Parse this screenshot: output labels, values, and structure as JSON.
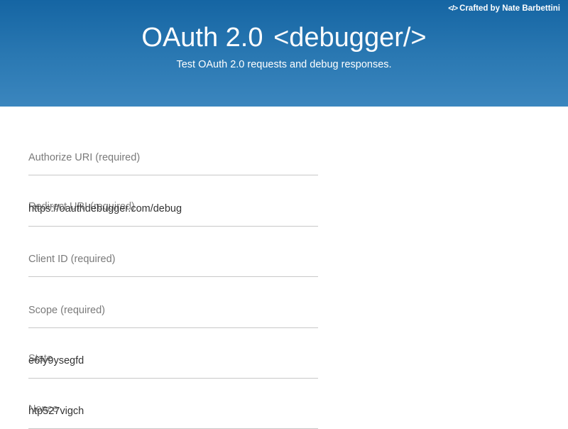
{
  "header": {
    "credit": {
      "icon": "code-icon",
      "icon_glyph": "</>",
      "text": "Crafted by Nate Barbettini"
    },
    "title_main": "OAuth 2.0",
    "title_tag": "<debugger/>",
    "subtitle": "Test OAuth 2.0 requests and debug responses."
  },
  "form": {
    "authorize_uri": {
      "label": "Authorize URI (required)",
      "value": ""
    },
    "redirect_uri": {
      "label": "Redirect URI (required)",
      "value": "https://oauthdebugger.com/debug"
    },
    "client_id": {
      "label": "Client ID (required)",
      "value": ""
    },
    "scope": {
      "label": "Scope (required)",
      "value": ""
    },
    "state": {
      "label": "State",
      "value": "e6fy9ysegfd"
    },
    "nonce": {
      "label": "Nonce",
      "value": "htp527vigch"
    }
  },
  "colors": {
    "header_top": "#1565a3",
    "header_bottom": "#3b86be",
    "field_border": "#c8c8c8",
    "label_text": "#7a7a7a",
    "input_text": "#333333"
  }
}
